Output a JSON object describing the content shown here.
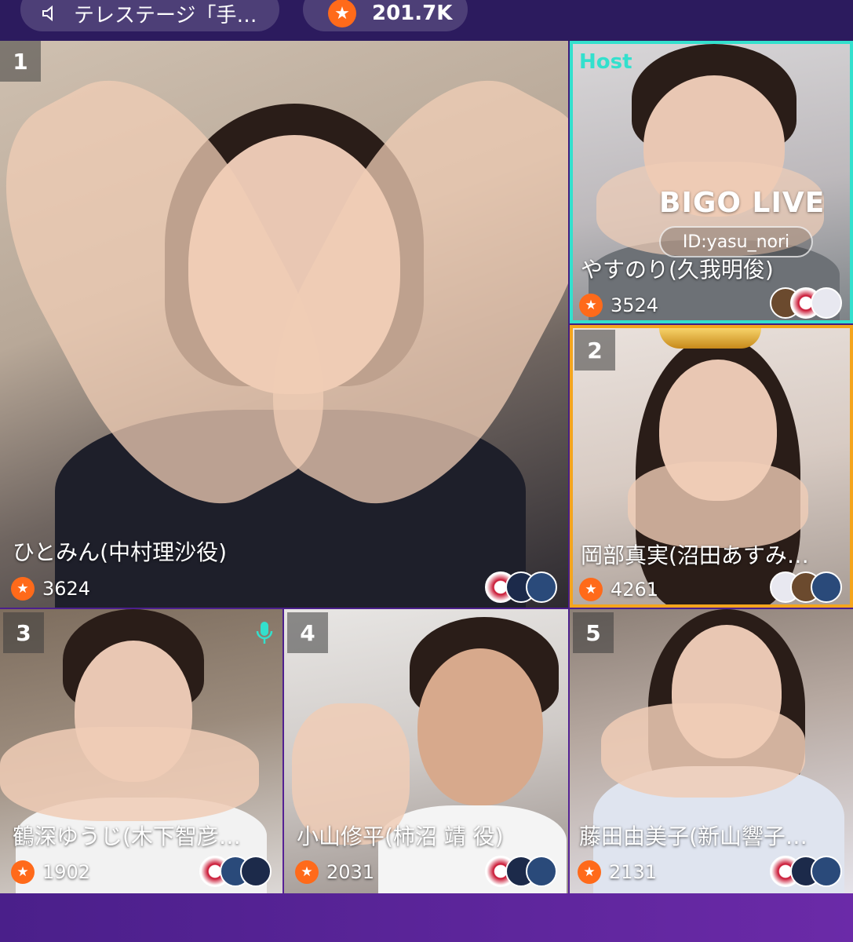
{
  "topbar": {
    "stage_label": "テレステージ「手…",
    "beans_total": "201.7K",
    "colors": {
      "coin": "#ff6a1a"
    }
  },
  "tiles": [
    {
      "rank": "1",
      "name": "ひとみん(中村理沙役)",
      "beans": "3624"
    },
    {
      "host_label": "Host",
      "watermark": "BIGO LIVE",
      "id_text": "ID:yasu_nori",
      "name": "やすのり(久我明俊)",
      "beans": "3524"
    },
    {
      "rank": "2",
      "name": "岡部真実(沼田あすみ…",
      "beans": "4261"
    },
    {
      "rank": "3",
      "name": "鶴深ゆうじ(木下智彦…",
      "beans": "1902"
    },
    {
      "rank": "4",
      "name": "小山修平(柿沼 靖 役)",
      "beans": "2031"
    },
    {
      "rank": "5",
      "name": "藤田由美子(新山響子…",
      "beans": "2131"
    }
  ],
  "colors": {
    "host_border": "#33e0cd",
    "rank2_border": "#f4a51e"
  },
  "icons": {
    "coin": "★"
  }
}
